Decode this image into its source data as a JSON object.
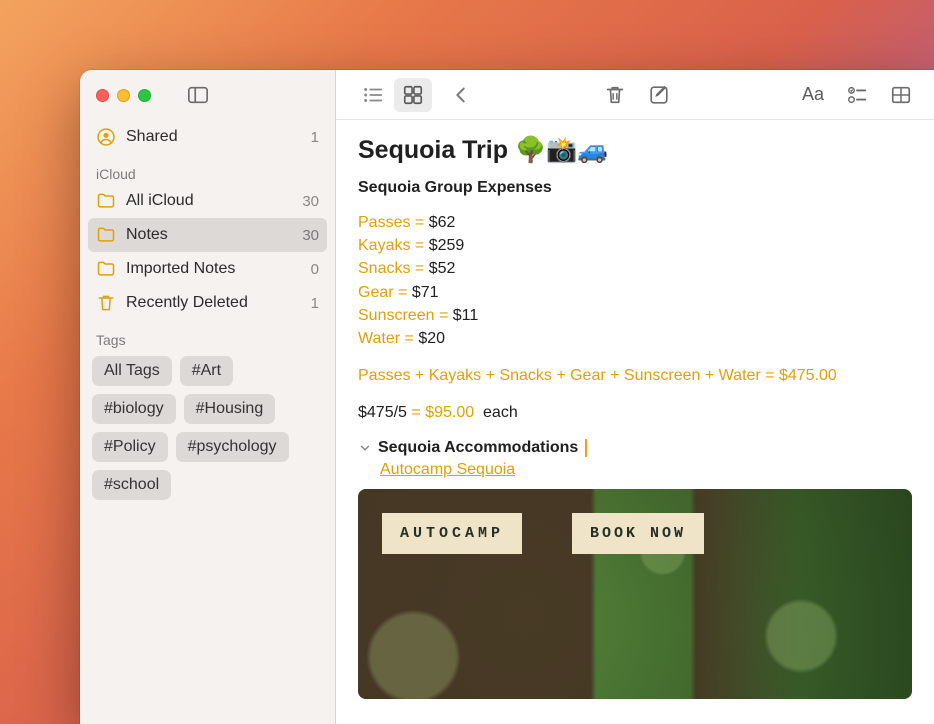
{
  "sidebar": {
    "shared": {
      "label": "Shared",
      "count": 1
    },
    "section_icloud": "iCloud",
    "folders": [
      {
        "label": "All iCloud",
        "count": 30,
        "selected": false
      },
      {
        "label": "Notes",
        "count": 30,
        "selected": true
      },
      {
        "label": "Imported Notes",
        "count": 0,
        "selected": false
      },
      {
        "label": "Recently Deleted",
        "count": 1,
        "selected": false,
        "trash": true
      }
    ],
    "section_tags": "Tags",
    "tags": [
      "All Tags",
      "#Art",
      "#biology",
      "#Housing",
      "#Policy",
      "#psychology",
      "#school"
    ]
  },
  "note": {
    "title": "Sequoia Trip 🌳📸🚙",
    "subtitle": "Sequoia Group Expenses",
    "expenses": [
      {
        "name": "Passes",
        "value": "$62"
      },
      {
        "name": "Kayaks",
        "value": "$259"
      },
      {
        "name": "Snacks",
        "value": "$52"
      },
      {
        "name": "Gear",
        "value": "$71"
      },
      {
        "name": "Sunscreen",
        "value": "$11"
      },
      {
        "name": "Water",
        "value": "$20"
      }
    ],
    "formula": {
      "terms": [
        "Passes",
        "Kayaks",
        "Snacks",
        "Gear",
        "Sunscreen",
        "Water"
      ],
      "result": "$475.00"
    },
    "perhead": {
      "lhs": "$475/5",
      "result": "$95.00",
      "suffix": "each"
    },
    "accommodations_heading": "Sequoia Accommodations",
    "accommodations_link": "Autocamp Sequoia",
    "attachment": {
      "logo": "AUTOCAMP",
      "cta": "BOOK NOW"
    }
  },
  "toolbar": {
    "aa_label": "Aa"
  }
}
